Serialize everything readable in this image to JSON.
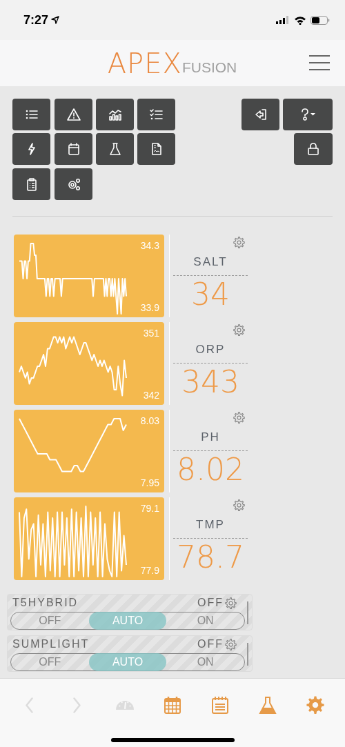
{
  "status_bar": {
    "time": "7:27"
  },
  "header": {
    "logo_main": "APEX",
    "logo_sub": "FUSION"
  },
  "probes": [
    {
      "max": "34.3",
      "min": "33.9",
      "name": "SALT",
      "value": "34"
    },
    {
      "max": "351",
      "min": "342",
      "name": "ORP",
      "value": "343"
    },
    {
      "max": "8.03",
      "min": "7.95",
      "name": "PH",
      "value": "8.02"
    },
    {
      "max": "79.1",
      "min": "77.9",
      "name": "TMP",
      "value": "78.7"
    }
  ],
  "outlets": [
    {
      "name": "T5HYBRID",
      "state": "OFF",
      "options": [
        {
          "label": "OFF",
          "selected": false
        },
        {
          "label": "AUTO",
          "selected": true
        },
        {
          "label": "ON",
          "selected": false
        }
      ]
    },
    {
      "name": "SUMPLIGHT",
      "state": "OFF",
      "options": [
        {
          "label": "OFF",
          "selected": false
        },
        {
          "label": "AUTO",
          "selected": true
        },
        {
          "label": "ON",
          "selected": false
        }
      ]
    }
  ],
  "bottom_nav": [
    {
      "kind": "back",
      "disabled": true
    },
    {
      "kind": "forward",
      "disabled": true
    },
    {
      "kind": "dashboard",
      "disabled": true
    },
    {
      "kind": "calendar",
      "disabled": false
    },
    {
      "kind": "notes",
      "disabled": false
    },
    {
      "kind": "flask",
      "disabled": false
    },
    {
      "kind": "settings",
      "disabled": false
    }
  ]
}
